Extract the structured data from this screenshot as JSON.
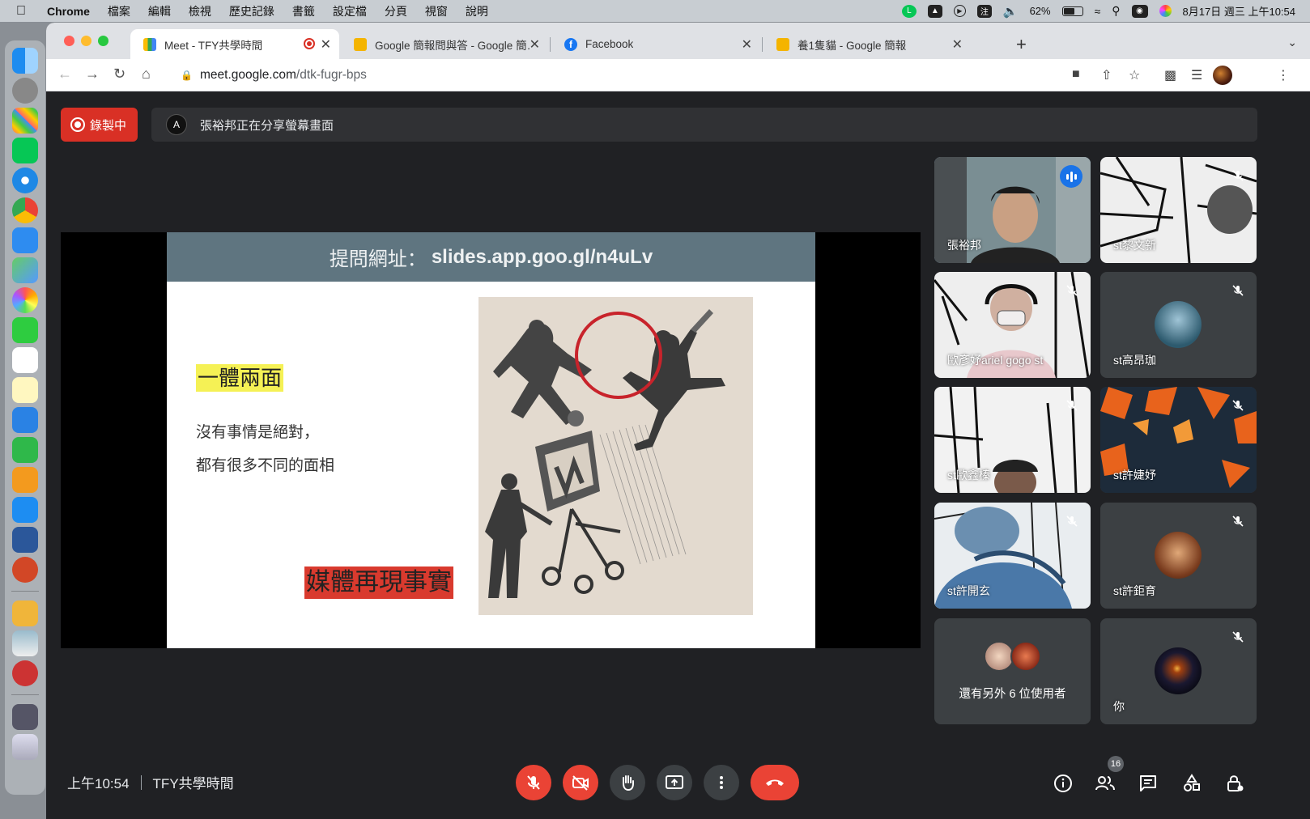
{
  "menubar": {
    "app": "Chrome",
    "items": [
      "檔案",
      "編輯",
      "檢視",
      "歷史記錄",
      "書籤",
      "設定檔",
      "分頁",
      "視窗",
      "說明"
    ],
    "battery": "62%",
    "datetime": "8月17日 週三 上午10:54",
    "battery_level": 0.62
  },
  "tabs": [
    {
      "title": "Meet - TFY共學時間",
      "active": true
    },
    {
      "title": "Google 簡報問與答 - Google 簡…",
      "active": false
    },
    {
      "title": "Facebook",
      "active": false
    },
    {
      "title": "養1隻貓 - Google 簡報",
      "active": false
    }
  ],
  "toolbar": {
    "url_host": "meet.google.com",
    "url_path": "/dtk-fugr-bps"
  },
  "meet": {
    "recording_label": "錄製中",
    "share_notice": "張裕邦正在分享螢幕畫面",
    "slide": {
      "header_label": "提問網址：",
      "header_url": "slides.app.goo.gl/n4uLv",
      "highlight_title": "一體兩面",
      "line1": "沒有事情是絕對，",
      "line2": "都有很多不同的面相",
      "footer_highlight": "媒體再現事實"
    },
    "participants": [
      {
        "name": "張裕邦",
        "speaking": true
      },
      {
        "name": "st黎文新",
        "muted": true
      },
      {
        "name": "歐彥妤ariel gogo st",
        "muted": true
      },
      {
        "name": "st高昂珈",
        "muted": true
      },
      {
        "name": "st歐鑫榛",
        "muted": true
      },
      {
        "name": "st許婕妤",
        "muted": true
      },
      {
        "name": "st許開玄",
        "muted": true
      },
      {
        "name": "st許鉅育",
        "muted": true
      },
      {
        "name": "還有另外 6 位使用者"
      },
      {
        "name": "你",
        "muted": true
      }
    ],
    "bottom": {
      "time": "上午10:54",
      "meeting_name": "TFY共學時間",
      "people_count": "16"
    }
  },
  "colors": {
    "meet_bg": "#202124",
    "tile_bg": "#3c4043",
    "danger": "#ea4335",
    "speaking_outline": "#8ab4f8"
  }
}
